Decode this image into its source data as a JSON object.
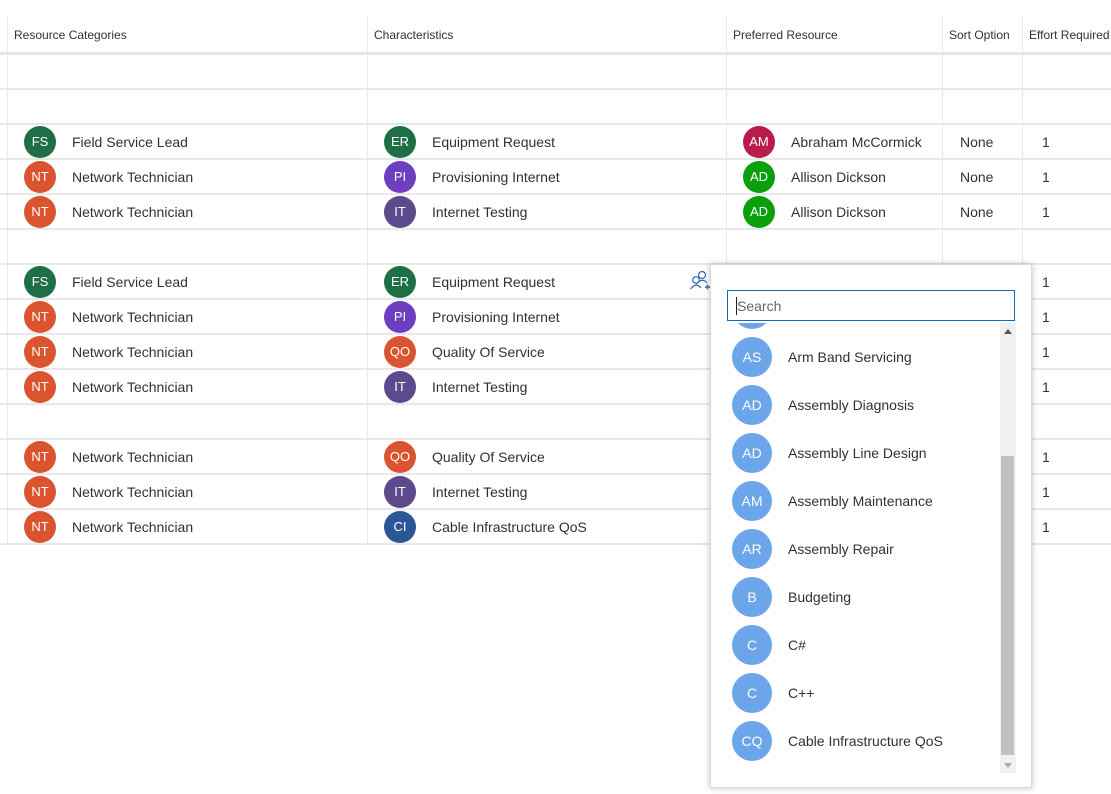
{
  "grid": {
    "columns": [
      "Resource Categories",
      "Characteristics",
      "Preferred Resource",
      "Sort Option",
      "Effort Required"
    ],
    "rows": [
      {
        "empty": true
      },
      {
        "empty": true
      },
      {
        "category": {
          "initials": "FS",
          "label": "Field Service Lead",
          "color": "#1e6e46"
        },
        "characteristic": {
          "initials": "ER",
          "label": "Equipment Request",
          "color": "#1e6e46"
        },
        "resource": {
          "initials": "AM",
          "label": "Abraham McCormick",
          "color": "#b91b4a"
        },
        "sort": "None",
        "effort": "1"
      },
      {
        "category": {
          "initials": "NT",
          "label": "Network Technician",
          "color": "#db5430"
        },
        "characteristic": {
          "initials": "PI",
          "label": "Provisioning Internet",
          "color": "#6b3fbf"
        },
        "resource": {
          "initials": "AD",
          "label": "Allison Dickson",
          "color": "#0b9f0b"
        },
        "sort": "None",
        "effort": "1"
      },
      {
        "category": {
          "initials": "NT",
          "label": "Network Technician",
          "color": "#db5430"
        },
        "characteristic": {
          "initials": "IT",
          "label": "Internet Testing",
          "color": "#5c4a8c"
        },
        "resource": {
          "initials": "AD",
          "label": "Allison Dickson",
          "color": "#0b9f0b"
        },
        "sort": "None",
        "effort": "1"
      },
      {
        "empty": true
      },
      {
        "category": {
          "initials": "FS",
          "label": "Field Service Lead",
          "color": "#1e6e46"
        },
        "characteristic": {
          "initials": "ER",
          "label": "Equipment Request",
          "color": "#1e6e46"
        },
        "resource": null,
        "sort": "",
        "effort": "1"
      },
      {
        "category": {
          "initials": "NT",
          "label": "Network Technician",
          "color": "#db5430"
        },
        "characteristic": {
          "initials": "PI",
          "label": "Provisioning Internet",
          "color": "#6b3fbf"
        },
        "resource": null,
        "sort": "",
        "effort": "1"
      },
      {
        "category": {
          "initials": "NT",
          "label": "Network Technician",
          "color": "#db5430"
        },
        "characteristic": {
          "initials": "QO",
          "label": "Quality Of Service",
          "color": "#db5430"
        },
        "resource": null,
        "sort": "",
        "effort": "1"
      },
      {
        "category": {
          "initials": "NT",
          "label": "Network Technician",
          "color": "#db5430"
        },
        "characteristic": {
          "initials": "IT",
          "label": "Internet Testing",
          "color": "#5c4a8c"
        },
        "resource": null,
        "sort": "",
        "effort": "1"
      },
      {
        "empty": true
      },
      {
        "category": {
          "initials": "NT",
          "label": "Network Technician",
          "color": "#db5430"
        },
        "characteristic": {
          "initials": "QO",
          "label": "Quality Of Service",
          "color": "#db5430"
        },
        "resource": null,
        "sort": "",
        "effort": "1"
      },
      {
        "category": {
          "initials": "NT",
          "label": "Network Technician",
          "color": "#db5430"
        },
        "characteristic": {
          "initials": "IT",
          "label": "Internet Testing",
          "color": "#5c4a8c"
        },
        "resource": null,
        "sort": "",
        "effort": "1"
      },
      {
        "category": {
          "initials": "NT",
          "label": "Network Technician",
          "color": "#db5430"
        },
        "characteristic": {
          "initials": "CI",
          "label": "Cable Infrastructure QoS",
          "color": "#2b5797"
        },
        "resource": null,
        "sort": "",
        "effort": "1"
      }
    ]
  },
  "assign_icon": "assign-people-icon",
  "picker": {
    "search_placeholder": "Search",
    "search_value": "",
    "items": [
      {
        "initials": "",
        "label": ""
      },
      {
        "initials": "AS",
        "label": "Arm Band Servicing"
      },
      {
        "initials": "AD",
        "label": "Assembly Diagnosis"
      },
      {
        "initials": "AD",
        "label": "Assembly Line Design"
      },
      {
        "initials": "AM",
        "label": "Assembly Maintenance"
      },
      {
        "initials": "AR",
        "label": "Assembly Repair"
      },
      {
        "initials": "B",
        "label": "Budgeting"
      },
      {
        "initials": "C",
        "label": "C#"
      },
      {
        "initials": "C",
        "label": "C++"
      },
      {
        "initials": "CQ",
        "label": "Cable Infrastructure QoS"
      }
    ],
    "avatar_color": "#6ca5e8",
    "accent_color": "#0f6cbd"
  }
}
